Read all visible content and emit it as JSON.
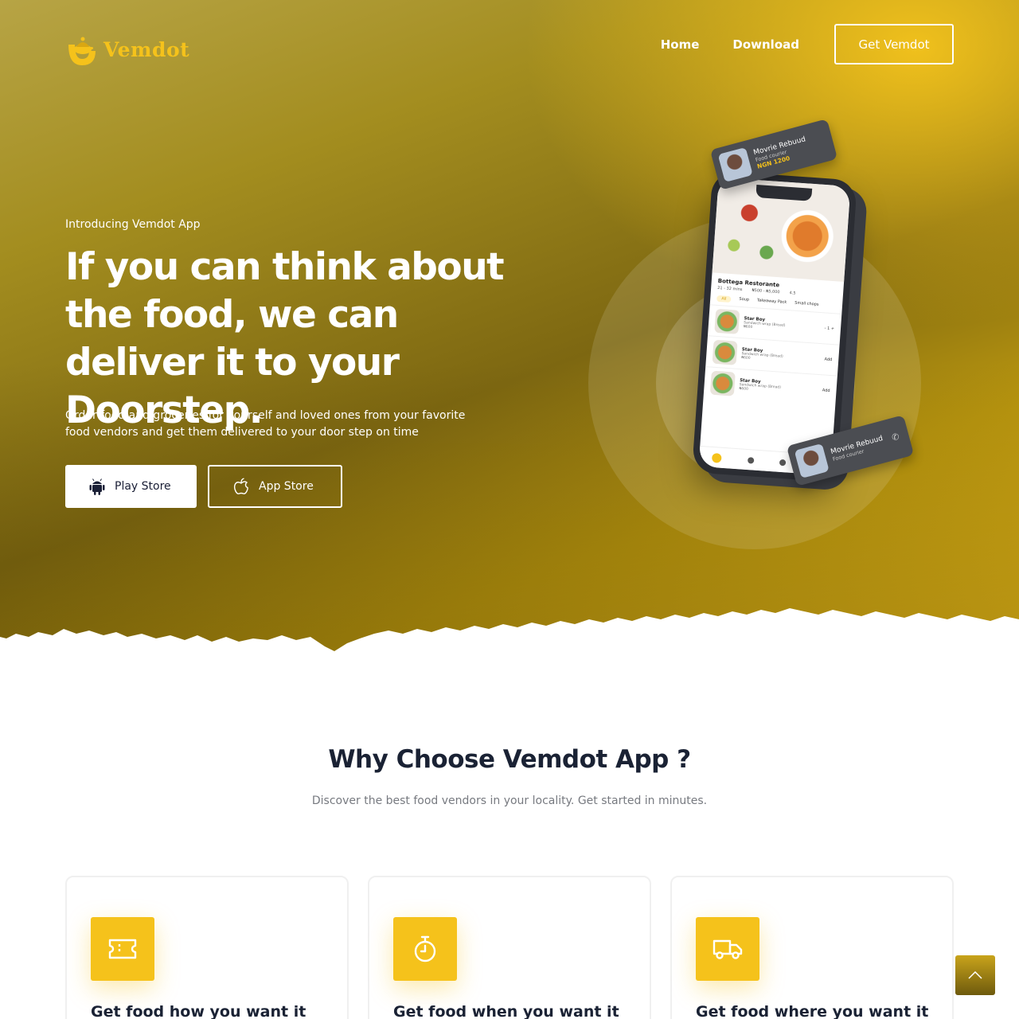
{
  "brand": {
    "name": "Vemdot"
  },
  "nav": {
    "items": [
      {
        "label": "Home"
      },
      {
        "label": "Download"
      }
    ],
    "cta_label": "Get Vemdot"
  },
  "hero": {
    "eyebrow": "Introducing Vemdot App",
    "headline": "If you can think about the food, we can deliver it to your Doorstep.",
    "description": "Order food and groceries for yourself and loved ones from your favorite food vendors and get them delivered to your door step on time",
    "play_store_label": "Play Store",
    "app_store_label": "App Store"
  },
  "mockup": {
    "restaurant": "Bottega Restorante",
    "time": "21 - 32 mins",
    "price_range": "₦500 - ₦5,000",
    "rating": "4.5",
    "tabs": [
      "All",
      "Soup",
      "Takeaway Pack",
      "Small chops"
    ],
    "items": [
      {
        "name": "Star Boy",
        "desc": "Sandwich wrap (Bread)",
        "price": "₦600",
        "action": "- 1 +"
      },
      {
        "name": "Star Boy",
        "desc": "Sandwich wrap (Bread)",
        "price": "₦600",
        "action": "Add"
      },
      {
        "name": "Star Boy",
        "desc": "Sandwich wrap (Bread)",
        "price": "₦600",
        "action": "Add"
      }
    ],
    "courier_top": {
      "name": "Movrie Rebuud",
      "role": "Food courier",
      "price": "NGN 1200"
    },
    "courier_bottom": {
      "name": "Movrie Rebuud",
      "role": "Food courier"
    }
  },
  "why": {
    "title": "Why Choose Vemdot App ?",
    "subtitle": "Discover the best food vendors in your locality. Get started in minutes.",
    "cards": [
      {
        "icon": "ticket-icon",
        "title": "Get food how you want it"
      },
      {
        "icon": "stopwatch-icon",
        "title": "Get food when you want it"
      },
      {
        "icon": "truck-icon",
        "title": "Get food where you want it"
      }
    ]
  },
  "colors": {
    "accent": "#f5c21b",
    "heading": "#1a2234",
    "muted": "#777a80"
  }
}
